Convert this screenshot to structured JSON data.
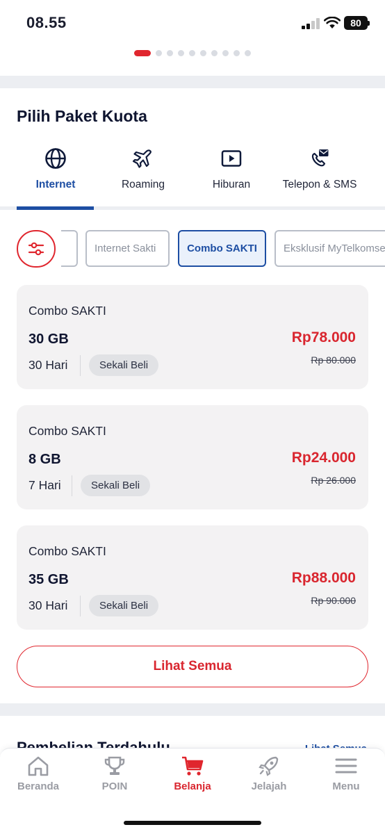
{
  "status": {
    "time": "08.55",
    "battery": "80"
  },
  "pager": {
    "count": 10,
    "active_index": 0
  },
  "section": {
    "title": "Pilih Paket Kuota"
  },
  "tabs": [
    {
      "label": "Internet",
      "icon": "globe-icon",
      "active": true
    },
    {
      "label": "Roaming",
      "icon": "airplane-icon",
      "active": false
    },
    {
      "label": "Hiburan",
      "icon": "play-icon",
      "active": false
    },
    {
      "label": "Telepon & SMS",
      "icon": "phone-message-icon",
      "active": false
    }
  ],
  "filters": {
    "icon": "sliders-icon",
    "chips": [
      {
        "label": "Internet Sakti",
        "active": false
      },
      {
        "label": "Combo SAKTI",
        "active": true
      },
      {
        "label": "Eksklusif MyTelkomsel",
        "active": false
      }
    ]
  },
  "packages": [
    {
      "name": "Combo SAKTI",
      "quota": "30 GB",
      "duration": "30 Hari",
      "badge": "Sekali Beli",
      "price": "Rp78.000",
      "old_price": "Rp 80.000"
    },
    {
      "name": "Combo SAKTI",
      "quota": "8 GB",
      "duration": "7 Hari",
      "badge": "Sekali Beli",
      "price": "Rp24.000",
      "old_price": "Rp 26.000"
    },
    {
      "name": "Combo SAKTI",
      "quota": "35 GB",
      "duration": "30 Hari",
      "badge": "Sekali Beli",
      "price": "Rp88.000",
      "old_price": "Rp 90.000"
    }
  ],
  "see_all_label": "Lihat Semua",
  "previous": {
    "title": "Pembelian Terdahulu",
    "link": "Lihat Semua"
  },
  "bottom_nav": [
    {
      "label": "Beranda",
      "icon": "home-icon",
      "active": false
    },
    {
      "label": "POIN",
      "icon": "trophy-icon",
      "active": false
    },
    {
      "label": "Belanja",
      "icon": "cart-icon",
      "active": true
    },
    {
      "label": "Jelajah",
      "icon": "rocket-icon",
      "active": false
    },
    {
      "label": "Menu",
      "icon": "menu-icon",
      "active": false
    }
  ],
  "colors": {
    "brand_red": "#d9262f",
    "brand_blue": "#1d4ea3",
    "card_bg": "#f3f2f3"
  }
}
